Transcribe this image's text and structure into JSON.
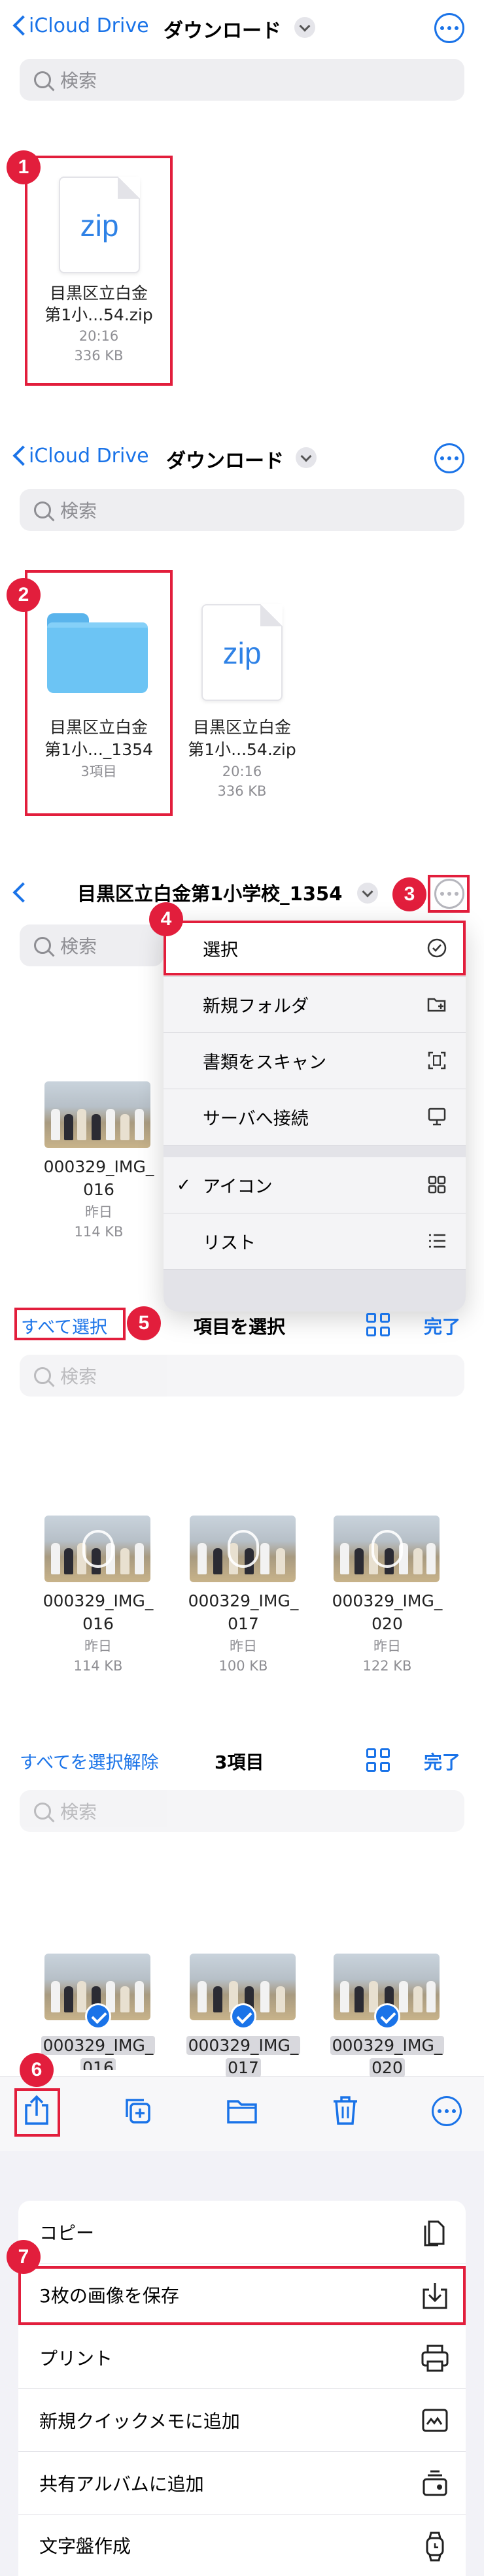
{
  "nav1": {
    "back": "iCloud Drive",
    "title": "ダウンロード"
  },
  "search": {
    "placeholder": "検索"
  },
  "zip_file": {
    "name1": "目黒区立白金",
    "name2": "第1小...54.zip",
    "time": "20:16",
    "size": "336 KB"
  },
  "folder": {
    "name1": "目黒区立白金",
    "name2": "第1小..._1354",
    "count": "3項目"
  },
  "nav3": {
    "title": "目黒区立白金第1小学校_1354"
  },
  "badges": [
    "1",
    "2",
    "3",
    "4",
    "5",
    "6",
    "7"
  ],
  "menu": {
    "items": [
      "選択",
      "新規フォルダ",
      "書類をスキャン",
      "サーバへ接続",
      "アイコン",
      "リスト"
    ]
  },
  "select_bar": {
    "select_all": "すべて選択",
    "title": "項目を選択",
    "done": "完了"
  },
  "deselect_bar": {
    "deselect_all": "すべてを選択解除",
    "title": "3項目",
    "done": "完了"
  },
  "photos": [
    {
      "name1": "000329_IMG_",
      "name2": "016",
      "date": "昨日",
      "size": "114 KB"
    },
    {
      "name1": "000329_IMG_",
      "name2": "017",
      "date": "昨日",
      "size": "100 KB"
    },
    {
      "name1": "000329_IMG_",
      "name2": "020",
      "date": "昨日",
      "size": "122 KB"
    }
  ],
  "selected_labels": {
    "a1": "000329_IMG_",
    "a2": "016",
    "b1": "000329_IMG_",
    "b2": "017",
    "c1": "000329_IMG_",
    "c2": "020"
  },
  "share_sheet": {
    "items": [
      "コピー",
      "3枚の画像を保存",
      "プリント",
      "新規クイックメモに追加",
      "共有アルバムに追加",
      "文字盤作成"
    ]
  },
  "colors": {
    "accent": "#1a73e8",
    "annotation": "#e21e3c"
  }
}
